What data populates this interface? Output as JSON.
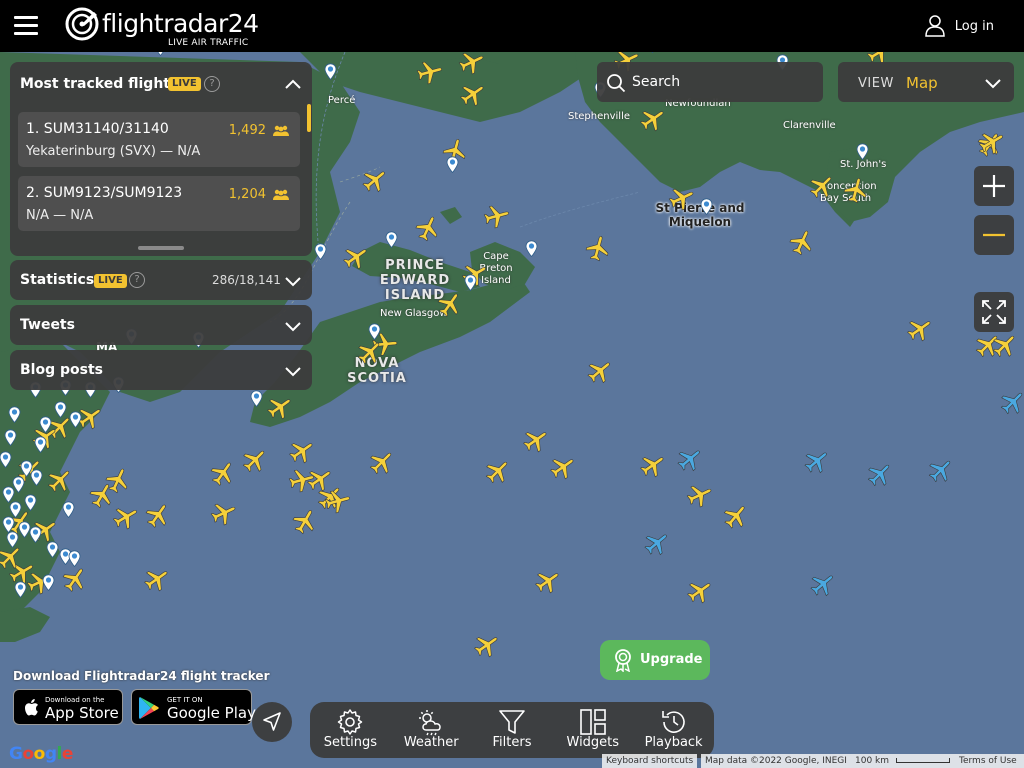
{
  "header": {
    "brand": "flightradar24",
    "tagline": "LIVE AIR TRAFFIC",
    "login_label": "Log in"
  },
  "most_tracked": {
    "title": "Most tracked flights",
    "live_badge": "LIVE",
    "help": "?",
    "flights": [
      {
        "id": "1. SUM31140/31140",
        "route": "Yekaterinburg (SVX) — N/A",
        "count": "1,492"
      },
      {
        "id": "2. SUM9123/SUM9123",
        "route": "N/A — N/A",
        "count": "1,204"
      }
    ]
  },
  "statistics": {
    "title": "Statistics",
    "live_badge": "LIVE",
    "help": "?",
    "value": "286/18,141"
  },
  "tweets": {
    "title": "Tweets"
  },
  "blog": {
    "title": "Blog posts"
  },
  "search": {
    "label": "Search"
  },
  "view": {
    "label": "VIEW",
    "value": "Map"
  },
  "map": {
    "regions": [
      "PRINCE EDWARD ISLAND",
      "NOVA SCOTIA"
    ],
    "places": {
      "perce": "Percé",
      "newfoundland": "Newfoundlan",
      "stephenville": "Stephenville",
      "clarenville": "Clarenville",
      "stjohns": "St. John's",
      "conception": "Conception Bay South",
      "cape_breton": "Cape Breton Island",
      "new_glasgow": "New Glasgow",
      "ma": "MA"
    },
    "island": "St Pierre and Miquelon"
  },
  "download": {
    "text": "Download Flightradar24 flight tracker",
    "appstore_small": "Download on the",
    "appstore_big": "App Store",
    "googleplay_small": "GET IT ON",
    "googleplay_big": "Google Play"
  },
  "toolbar": [
    {
      "label": "Settings",
      "icon": "gear-icon"
    },
    {
      "label": "Weather",
      "icon": "weather-icon"
    },
    {
      "label": "Filters",
      "icon": "filter-icon"
    },
    {
      "label": "Widgets",
      "icon": "widgets-icon"
    },
    {
      "label": "Playback",
      "icon": "playback-icon"
    }
  ],
  "upgrade": {
    "label": "Upgrade"
  },
  "attribution": {
    "shortcuts": "Keyboard shortcuts",
    "map_data": "Map data ©2022 Google, INEGI",
    "scale": "100 km",
    "terms": "Terms of Use"
  },
  "google": "Google",
  "colors": {
    "accent": "#f2c230",
    "plane_yellow": "#f5d03a",
    "plane_blue": "#4aa8e0",
    "water": "#5b769c",
    "land": "#3f6b4a",
    "upgrade": "#5cb85c"
  }
}
